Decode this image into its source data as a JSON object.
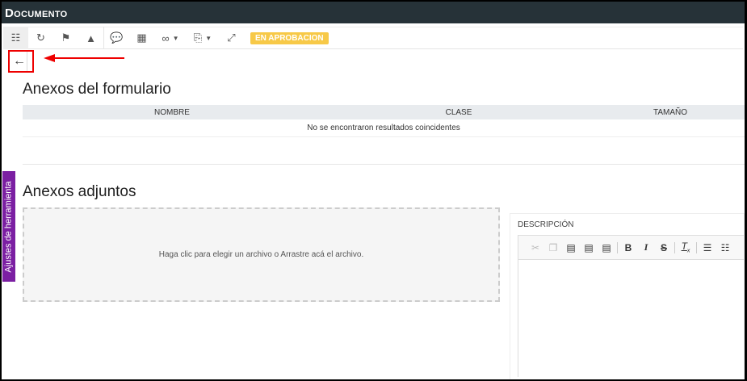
{
  "window": {
    "title": "Documento"
  },
  "toolbar": {
    "status_badge": "EN APROBACION",
    "status_color": "#f7c948"
  },
  "form_attachments": {
    "title": "Anexos del formulario",
    "columns": [
      "NOMBRE",
      "CLASE",
      "TAMAÑO"
    ],
    "empty_message": "No se encontraron resultados coincidentes"
  },
  "attachments": {
    "title": "Anexos adjuntos",
    "dropzone_text": "Haga clic para elegir un archivo o Arrastre acá el archivo."
  },
  "description": {
    "label": "DESCRIPCIÓN"
  },
  "side_tab": {
    "label": "Ajustes de herramienta",
    "color": "#7b1fa2"
  }
}
